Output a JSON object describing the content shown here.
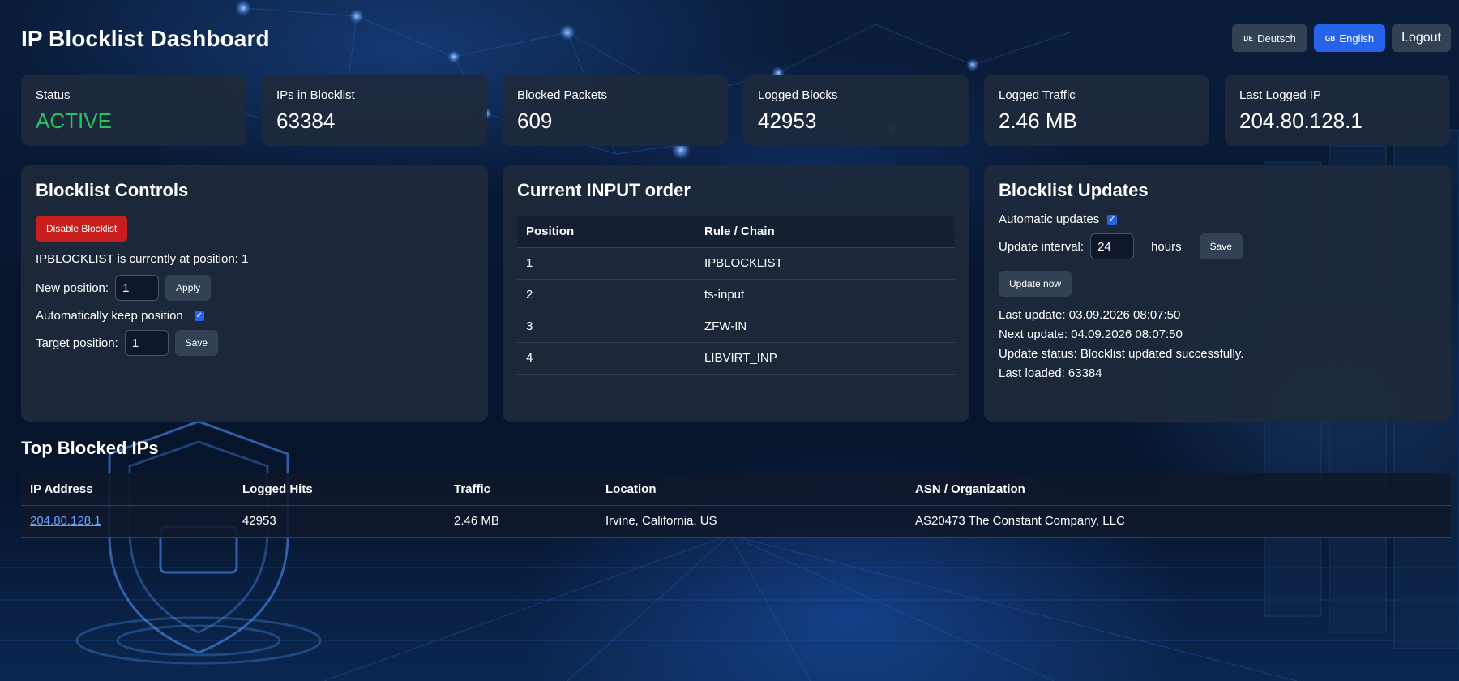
{
  "header": {
    "title": "IP Blocklist Dashboard",
    "lang_de_flag": "DE",
    "lang_de_label": "Deutsch",
    "lang_en_flag": "GB",
    "lang_en_label": "English",
    "logout_label": "Logout"
  },
  "stats": [
    {
      "label": "Status",
      "value": "ACTIVE"
    },
    {
      "label": "IPs in Blocklist",
      "value": "63384"
    },
    {
      "label": "Blocked Packets",
      "value": "609"
    },
    {
      "label": "Logged Blocks",
      "value": "42953"
    },
    {
      "label": "Logged Traffic",
      "value": "2.46 MB"
    },
    {
      "label": "Last Logged IP",
      "value": "204.80.128.1"
    }
  ],
  "controls": {
    "title": "Blocklist Controls",
    "disable_label": "Disable Blocklist",
    "position_text": "IPBLOCKLIST is currently at position: 1",
    "new_position_label": "New position:",
    "new_position_value": "1",
    "apply_label": "Apply",
    "auto_keep_label": "Automatically keep position",
    "target_label": "Target position:",
    "target_value": "1",
    "save_label": "Save"
  },
  "input_order": {
    "title": "Current INPUT order",
    "columns": [
      "Position",
      "Rule / Chain"
    ],
    "rows": [
      [
        "1",
        "IPBLOCKLIST"
      ],
      [
        "2",
        "ts-input"
      ],
      [
        "3",
        "ZFW-IN"
      ],
      [
        "4",
        "LIBVIRT_INP"
      ]
    ]
  },
  "updates": {
    "title": "Blocklist Updates",
    "auto_label": "Automatic updates",
    "interval_label": "Update interval:",
    "interval_value": "24",
    "hours_label": "hours",
    "save_label": "Save",
    "update_now_label": "Update now",
    "last_update": "Last update: 03.09.2026 08:07:50",
    "next_update": "Next update: 04.09.2026 08:07:50",
    "status": "Update status: Blocklist updated successfully.",
    "last_loaded": "Last loaded: 63384"
  },
  "top_blocked": {
    "title": "Top Blocked IPs",
    "columns": [
      "IP Address",
      "Logged Hits",
      "Traffic",
      "Location",
      "ASN / Organization"
    ],
    "rows": [
      [
        "204.80.128.1",
        "42953",
        "2.46 MB",
        "Irvine, California, US",
        "AS20473 The Constant Company, LLC"
      ]
    ]
  },
  "colors": {
    "accent": "#2563eb",
    "active_status": "#22c55e",
    "danger": "#c81e1e",
    "panel": "#1e293b",
    "link": "#60a5fa"
  }
}
